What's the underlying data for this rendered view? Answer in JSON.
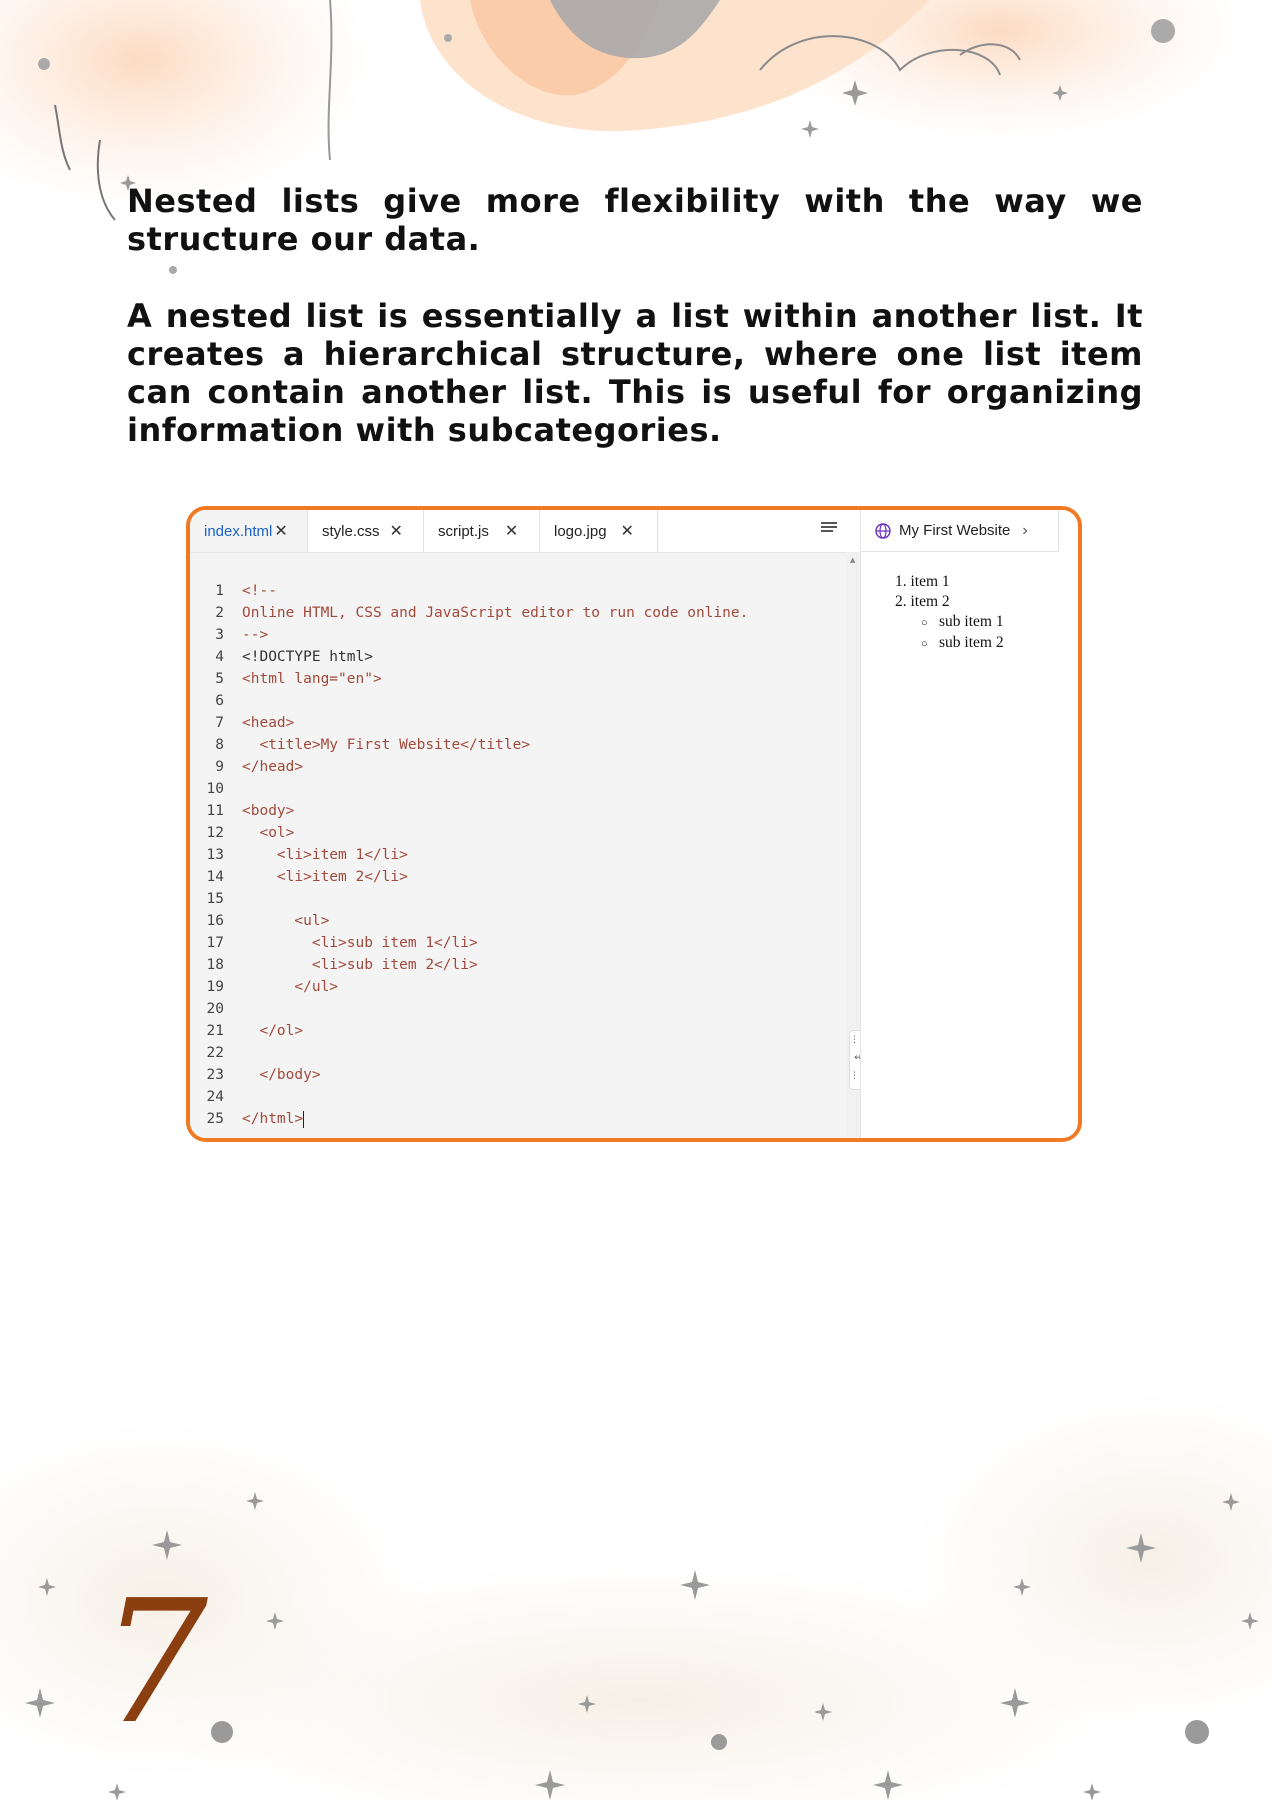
{
  "colors": {
    "accent_border": "#f07a23",
    "page_number": "#8b3f10",
    "active_tab": "#1a62c9"
  },
  "paragraphs": {
    "p1": "Nested lists give more flexibility with the way we structure our data.",
    "p2": "A nested list is essentially a list within another list. It creates a hierarchical structure, where one list item can contain another list. This is useful for organizing information with subcategories."
  },
  "editor": {
    "tabs": [
      {
        "label": "index.html",
        "close": "✕",
        "active": true
      },
      {
        "label": "style.css",
        "close": "✕"
      },
      {
        "label": "script.js",
        "close": "✕"
      },
      {
        "label": "logo.jpg",
        "close": "✕"
      }
    ],
    "icons": {
      "menu": "menu-lines-icon",
      "close": "close-icon",
      "globe": "globe-icon",
      "chevron": "chevron-right-icon"
    },
    "code_lines": [
      {
        "n": "1",
        "text": "<!--"
      },
      {
        "n": "2",
        "text": "Online HTML, CSS and JavaScript editor to run code online."
      },
      {
        "n": "3",
        "text": "-->"
      },
      {
        "n": "4",
        "text": "<!DOCTYPE html>"
      },
      {
        "n": "5",
        "text": "<html lang=\"en\">"
      },
      {
        "n": "6",
        "text": ""
      },
      {
        "n": "7",
        "text": "<head>"
      },
      {
        "n": "8",
        "text": "  <title>My First Website</title>"
      },
      {
        "n": "9",
        "text": "</head>"
      },
      {
        "n": "10",
        "text": ""
      },
      {
        "n": "11",
        "text": "<body>"
      },
      {
        "n": "12",
        "text": "  <ol>"
      },
      {
        "n": "13",
        "text": "    <li>item 1</li>"
      },
      {
        "n": "14",
        "text": "    <li>item 2</li>"
      },
      {
        "n": "15",
        "text": ""
      },
      {
        "n": "16",
        "text": "      <ul>"
      },
      {
        "n": "17",
        "text": "        <li>sub item 1</li>"
      },
      {
        "n": "18",
        "text": "        <li>sub item 2</li>"
      },
      {
        "n": "19",
        "text": "      </ul>"
      },
      {
        "n": "20",
        "text": ""
      },
      {
        "n": "21",
        "text": "  </ol>"
      },
      {
        "n": "22",
        "text": ""
      },
      {
        "n": "23",
        "text": "  </body>"
      },
      {
        "n": "24",
        "text": ""
      },
      {
        "n": "25",
        "text": "</html>"
      }
    ]
  },
  "preview": {
    "tab_label": "My First Website",
    "ordered_items": [
      "1. item 1",
      "2. item 2"
    ],
    "sub_items": [
      "sub item 1",
      "sub item 2"
    ]
  },
  "page_number": "7"
}
